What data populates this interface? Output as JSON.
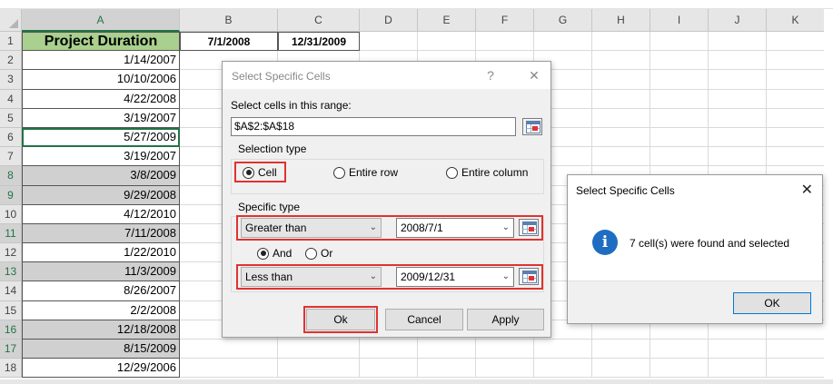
{
  "sheet": {
    "columns": [
      "A",
      "B",
      "C",
      "D",
      "E",
      "F",
      "G",
      "H",
      "I",
      "J",
      "K"
    ],
    "header_row": {
      "A1": "Project Duration",
      "B1": "7/1/2008",
      "C1": "12/31/2009"
    },
    "rows": [
      {
        "num": "1"
      },
      {
        "num": "2",
        "value": "1/14/2007"
      },
      {
        "num": "3",
        "value": "10/10/2006"
      },
      {
        "num": "4",
        "value": "4/22/2008"
      },
      {
        "num": "5",
        "value": "3/19/2007"
      },
      {
        "num": "6",
        "value": "5/27/2009"
      },
      {
        "num": "7",
        "value": "3/19/2007"
      },
      {
        "num": "8",
        "value": "3/8/2009"
      },
      {
        "num": "9",
        "value": "9/29/2008"
      },
      {
        "num": "10",
        "value": "4/12/2010"
      },
      {
        "num": "11",
        "value": "7/11/2008"
      },
      {
        "num": "12",
        "value": "1/22/2010"
      },
      {
        "num": "13",
        "value": "11/3/2009"
      },
      {
        "num": "14",
        "value": "8/26/2007"
      },
      {
        "num": "15",
        "value": "2/2/2008"
      },
      {
        "num": "16",
        "value": "12/18/2008"
      },
      {
        "num": "17",
        "value": "8/15/2009"
      },
      {
        "num": "18",
        "value": "12/29/2006"
      }
    ]
  },
  "dialog": {
    "title": "Select Specific Cells",
    "help": "?",
    "close": "✕",
    "range_label": "Select cells in this range:",
    "range_value": "$A$2:$A$18",
    "selection_type_label": "Selection type",
    "options": {
      "cell": "Cell",
      "entire_row": "Entire row",
      "entire_column": "Entire column"
    },
    "specific_type_label": "Specific type",
    "condition1": {
      "operator": "Greater than",
      "value": "2008/7/1"
    },
    "logic": {
      "and": "And",
      "or": "Or"
    },
    "condition2": {
      "operator": "Less than",
      "value": "2009/12/31"
    },
    "buttons": {
      "ok": "Ok",
      "cancel": "Cancel",
      "apply": "Apply"
    }
  },
  "info_dialog": {
    "title": "Select Specific Cells",
    "close": "✕",
    "icon": "i",
    "message": "7 cell(s) were found and selected",
    "ok": "OK"
  },
  "colors": {
    "header_fill": "#a9d08e",
    "selected_fill": "#d0d0d0",
    "highlight_border": "#e0322f",
    "excel_green": "#217346",
    "info_blue": "#1f6dc2"
  }
}
